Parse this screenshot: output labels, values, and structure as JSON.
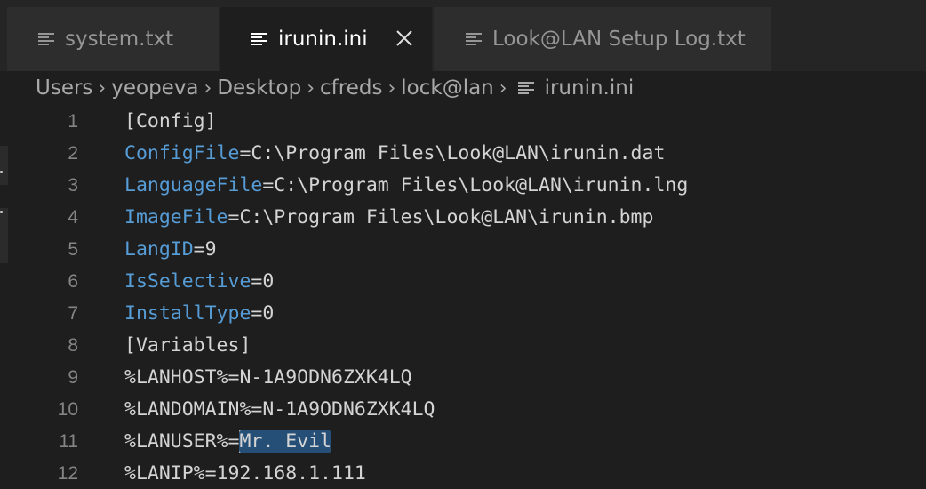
{
  "tabs": [
    {
      "label": "system.txt",
      "active": false
    },
    {
      "label": "irunin.ini",
      "active": true
    },
    {
      "label": "Look@LAN Setup Log.txt",
      "active": false
    }
  ],
  "breadcrumb": [
    "Users",
    "yeopeva",
    "Desktop",
    "cfreds",
    "lock@lan",
    "irunin.ini"
  ],
  "lines": [
    {
      "n": "1",
      "key": "",
      "rest": "[Config]"
    },
    {
      "n": "2",
      "key": "ConfigFile",
      "rest": "=C:\\Program Files\\Look@LAN\\irunin.dat"
    },
    {
      "n": "3",
      "key": "LanguageFile",
      "rest": "=C:\\Program Files\\Look@LAN\\irunin.lng"
    },
    {
      "n": "4",
      "key": "ImageFile",
      "rest": "=C:\\Program Files\\Look@LAN\\irunin.bmp"
    },
    {
      "n": "5",
      "key": "LangID",
      "rest": "=9"
    },
    {
      "n": "6",
      "key": "IsSelective",
      "rest": "=0"
    },
    {
      "n": "7",
      "key": "InstallType",
      "rest": "=0"
    },
    {
      "n": "8",
      "key": "",
      "rest": "[Variables]"
    },
    {
      "n": "9",
      "key": "",
      "rest": "%LANHOST%=N-1A9ODN6ZXK4LQ"
    },
    {
      "n": "10",
      "key": "",
      "rest": "%LANDOMAIN%=N-1A9ODN6ZXK4LQ"
    },
    {
      "n": "11",
      "key": "",
      "rest": "%LANUSER%=",
      "selected": "Mr. Evil"
    },
    {
      "n": "12",
      "key": "",
      "rest": "%LANIP%=192.168.1.111"
    }
  ],
  "colors": {
    "background": "#1e1e1e",
    "tabbar": "#252526",
    "key": "#569cd6",
    "text": "#d4d4d4",
    "line_number": "#858585",
    "selection": "#264f78"
  },
  "icons": {
    "tab_icon": "file-lines-icon",
    "close": "close-icon",
    "breadcrumb_separator": "chevron-right-icon"
  }
}
